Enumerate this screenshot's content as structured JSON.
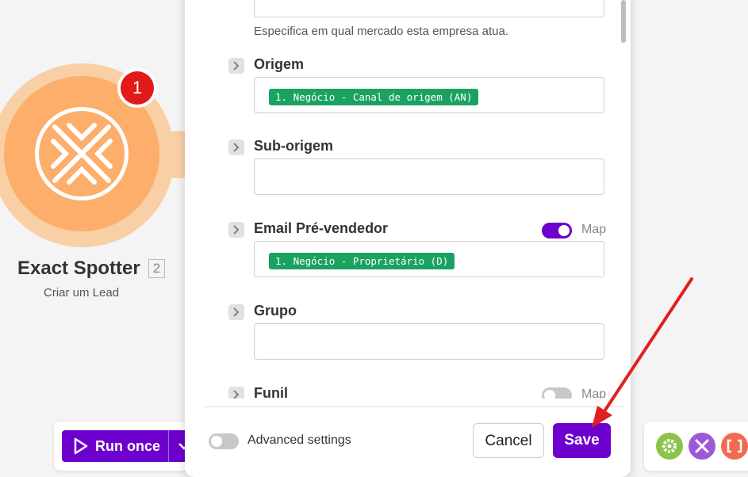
{
  "module": {
    "title": "Exact Spotter",
    "index": "2",
    "subtitle": "Criar um Lead",
    "badge_count": "1",
    "icon": "exact-spotter-arrows-icon"
  },
  "modal": {
    "helper_text": "Especifica em qual mercado esta empresa atua.",
    "fields": [
      {
        "label": "Origem",
        "value": "1. Negócio - Canal de origem (AN)",
        "map": null
      },
      {
        "label": "Sub-origem",
        "value": "",
        "map": null
      },
      {
        "label": "Email Pré-vendedor",
        "value": "1. Negócio - Proprietário (D)",
        "map": {
          "label": "Map",
          "on": true
        }
      },
      {
        "label": "Grupo",
        "value": "",
        "map": null
      },
      {
        "label": "Funil",
        "value": "",
        "map": {
          "label": "Map",
          "on": false
        }
      }
    ],
    "footer": {
      "advanced_label": "Advanced settings",
      "cancel_label": "Cancel",
      "save_label": "Save"
    }
  },
  "toolbar": {
    "run_once_label": "Run once"
  },
  "colors": {
    "primary": "#6d00cc",
    "module_orange": "#fdae6b",
    "pill_green": "#1aa260",
    "badge_red": "#e21a1a",
    "arrow_red": "#e02020"
  }
}
